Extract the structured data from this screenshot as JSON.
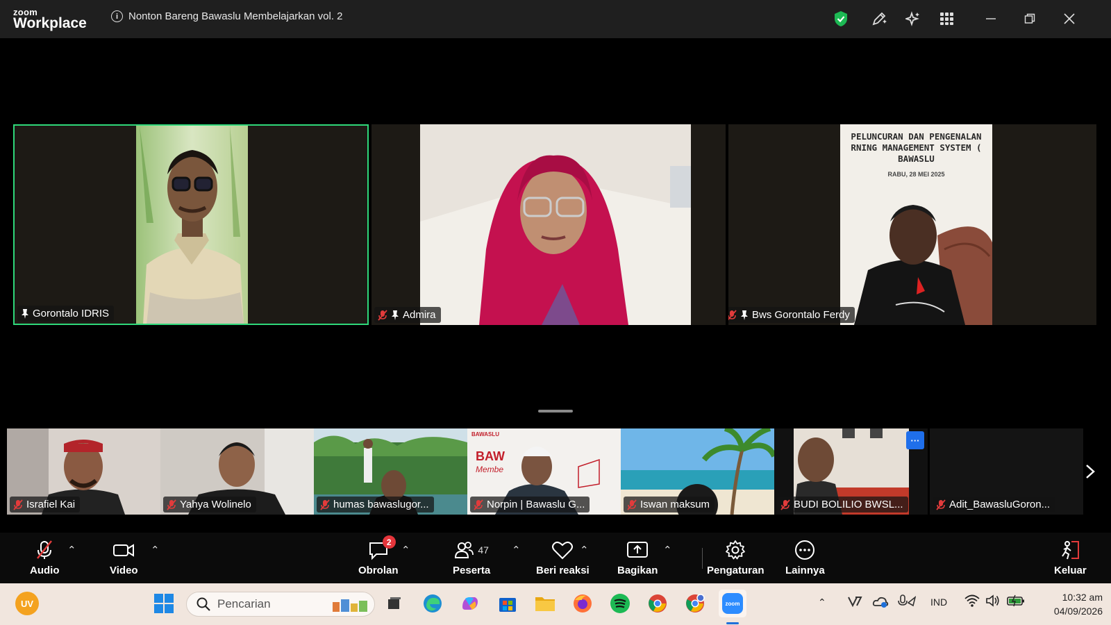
{
  "app": {
    "logo_top": "zoom",
    "logo_bottom": "Workplace"
  },
  "meeting": {
    "title": "Nonton Bareng Bawaslu Membelajarkan vol. 2"
  },
  "colors": {
    "active_border": "#2fd87a",
    "shield": "#1db954",
    "badge": "#e5353b"
  },
  "main_tiles": [
    {
      "name": "Gorontalo IDRIS",
      "muted": false,
      "pinned": true,
      "active": true
    },
    {
      "name": "Admira",
      "muted": true,
      "pinned": true,
      "active": false
    },
    {
      "name": "Bws Gorontalo Ferdy",
      "muted": true,
      "pinned": true,
      "active": false
    }
  ],
  "slide": {
    "line1": "PELUNCURAN DAN PENGENALAN",
    "line2": "RNING MANAGEMENT SYSTEM (",
    "line3": "BAWASLU",
    "date": "RABU, 28 MEI 2025"
  },
  "gallery": [
    {
      "name": "Israfiel Kai"
    },
    {
      "name": "Yahya Wolinelo"
    },
    {
      "name": "humas bawaslugor..."
    },
    {
      "name": "Norpin | Bawaslu G..."
    },
    {
      "name": "Iswan maksum"
    },
    {
      "name": "BUDI BOLILIO BWSL..."
    },
    {
      "name": "Adit_BawasluGoron..."
    }
  ],
  "gallery_text": {
    "bawaslu_logo": "BAWASLU",
    "bawaslu_big": "BAW",
    "bawaslu_sub": "Membe",
    "more_dots": "···"
  },
  "toolbar": {
    "audio": "Audio",
    "video": "Video",
    "chat": "Obrolan",
    "chat_badge": "2",
    "participants": "Peserta",
    "participants_count": "47",
    "react": "Beri reaksi",
    "share": "Bagikan",
    "settings": "Pengaturan",
    "more": "Lainnya",
    "leave": "Keluar"
  },
  "taskbar": {
    "avatar": "UV",
    "search_placeholder": "Pencarian",
    "lang": "IND",
    "time": "10:32 am",
    "date": "04/09/2026",
    "zoom_label": "zoom"
  }
}
